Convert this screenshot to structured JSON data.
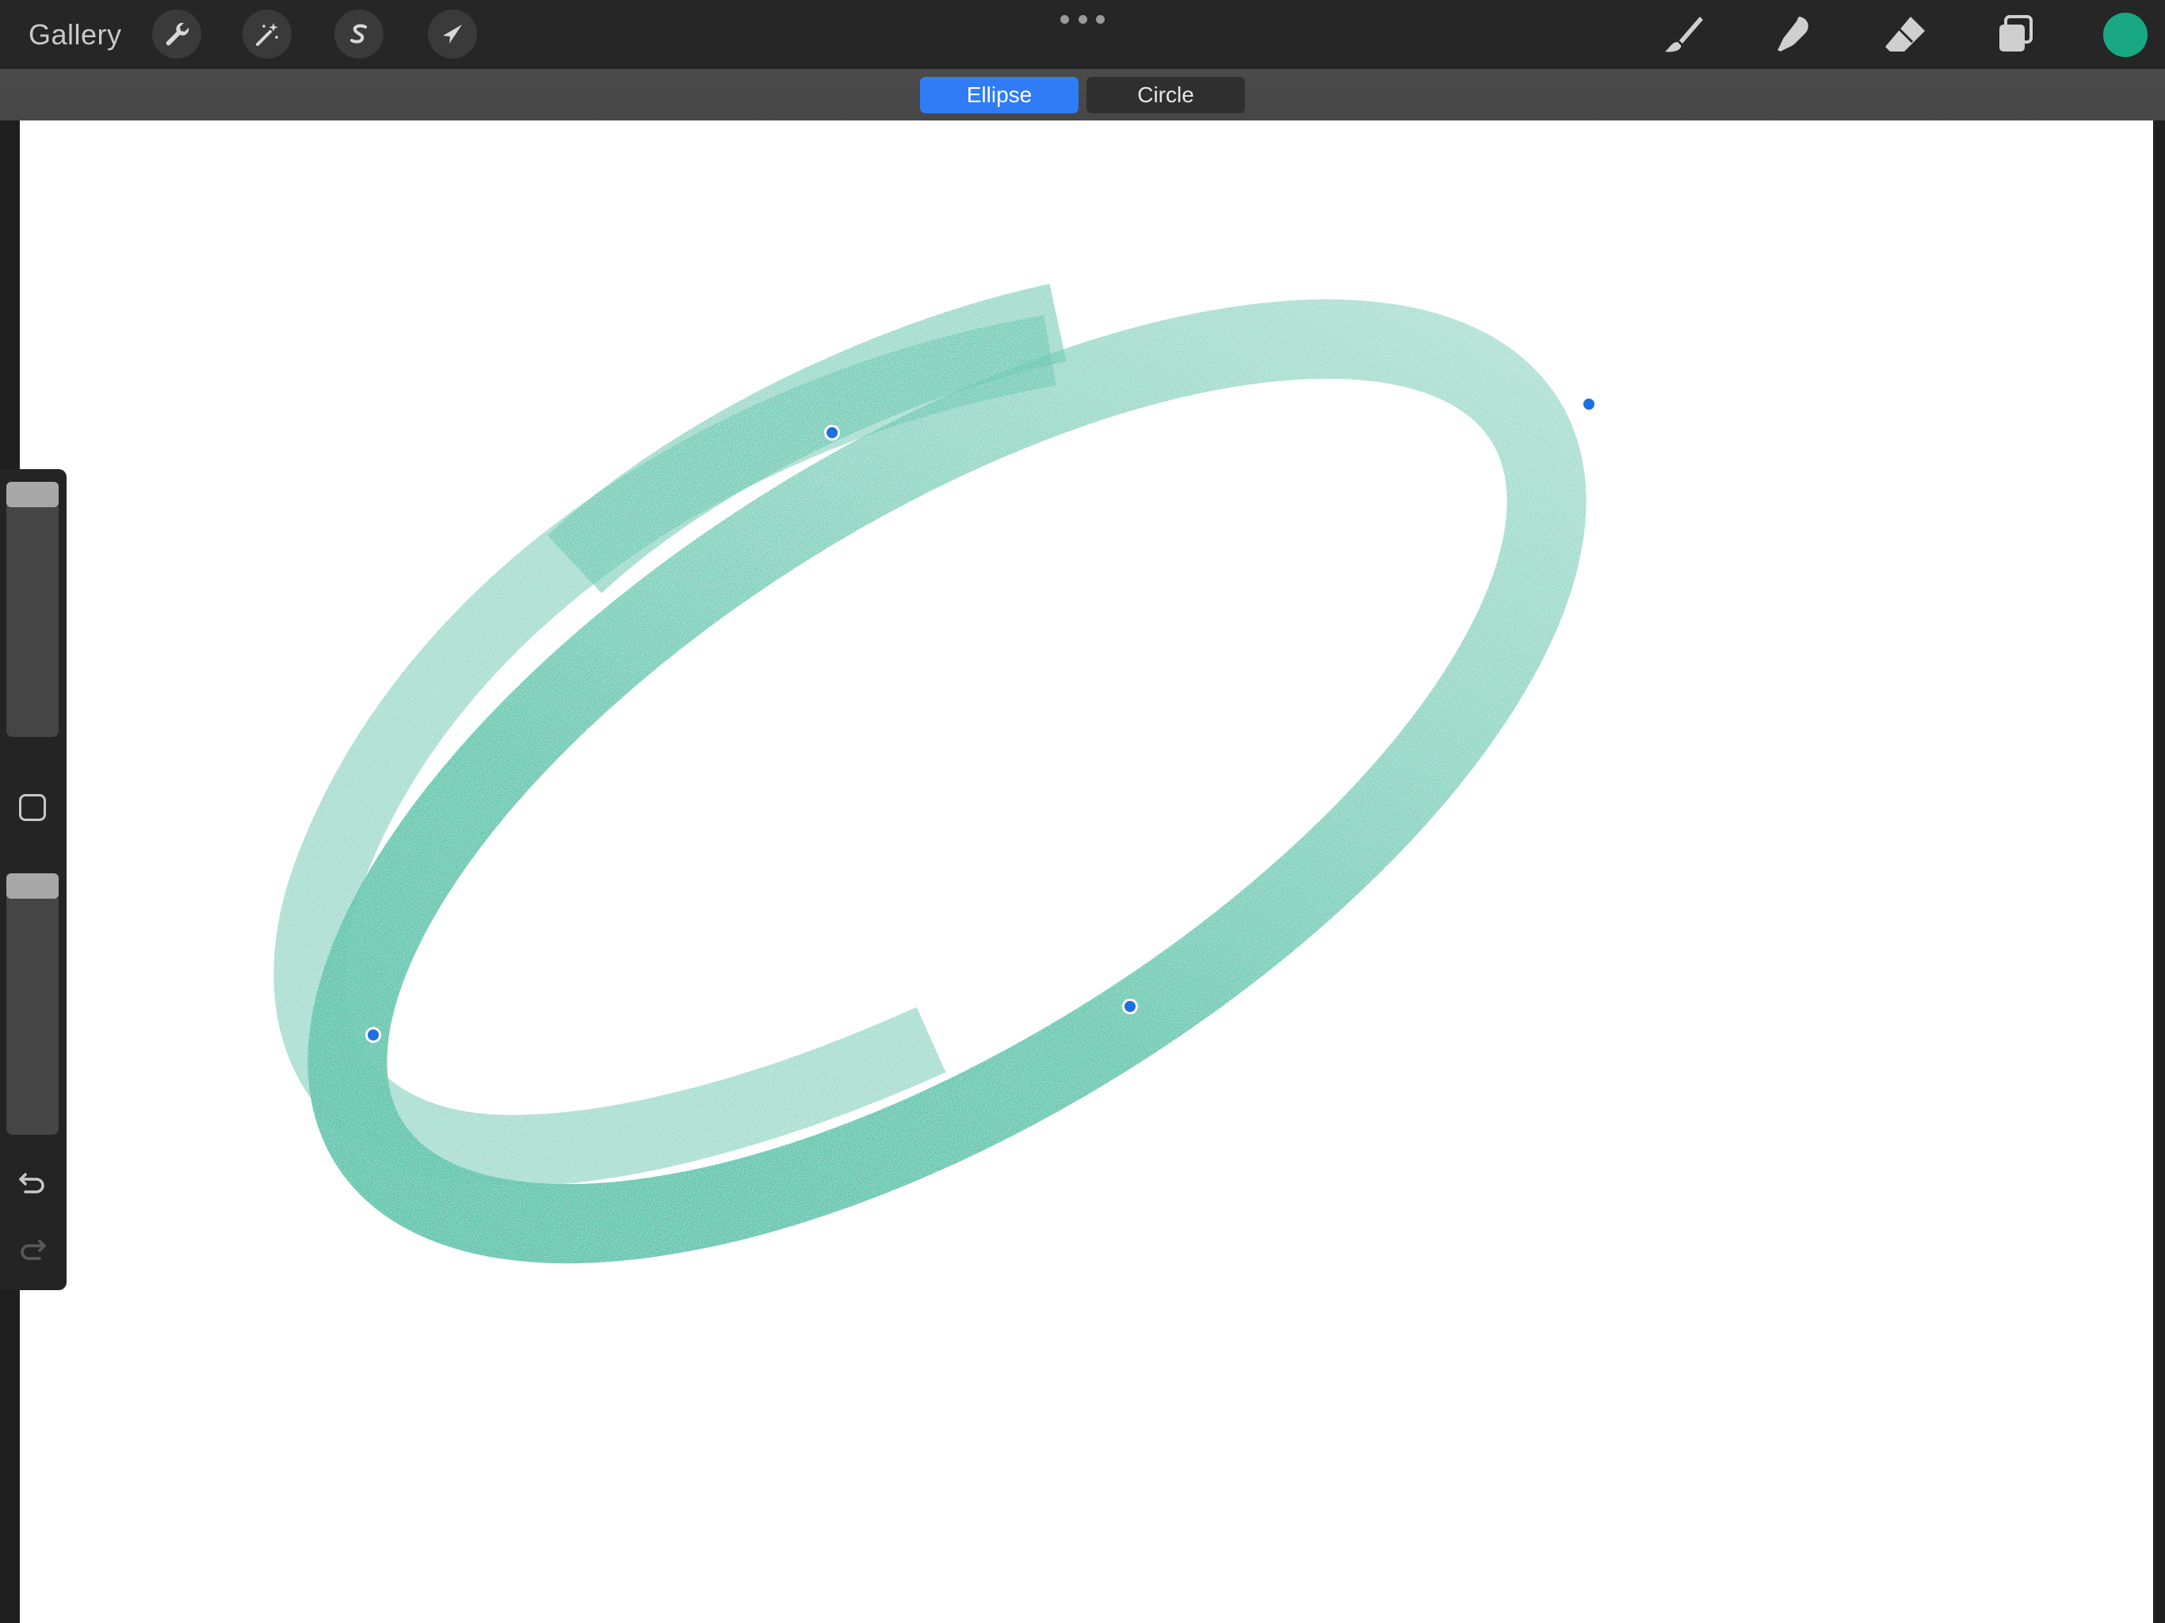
{
  "app": {
    "gallery_label": "Gallery"
  },
  "toolbar": {
    "left_tools": [
      {
        "name": "actions",
        "icon": "wrench-icon"
      },
      {
        "name": "adjustments",
        "icon": "magic-wand-icon"
      },
      {
        "name": "selection",
        "icon": "selection-s-icon"
      },
      {
        "name": "transform",
        "icon": "arrow-cursor-icon"
      }
    ],
    "more_icon": "ellipsis-icon",
    "right_tools": [
      {
        "name": "brush",
        "icon": "brush-icon"
      },
      {
        "name": "smudge",
        "icon": "smudge-icon"
      },
      {
        "name": "eraser",
        "icon": "eraser-icon"
      },
      {
        "name": "layers",
        "icon": "layers-icon"
      }
    ],
    "current_color": "#18a884"
  },
  "shape_options": {
    "ellipse_label": "Ellipse",
    "circle_label": "Circle",
    "selected": "Ellipse",
    "selected_color": "#2f7cf6"
  },
  "canvas": {
    "stroke_color": "#18a884",
    "handle_color": "#1e6fe0",
    "shape": "ellipse",
    "handle_count": 4
  },
  "sidebar": {
    "brush_size_level": 0.0,
    "opacity_level": 0.0,
    "modify_icon": "square-icon",
    "undo_icon": "undo-icon",
    "redo_icon": "redo-icon",
    "redo_enabled": false
  }
}
